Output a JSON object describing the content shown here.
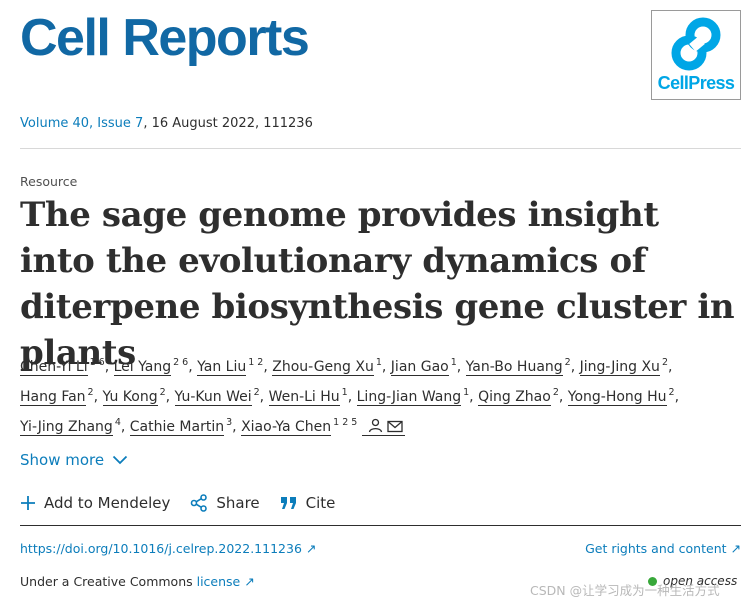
{
  "journal": {
    "title": "Cell Reports",
    "publisher_logo_text": "CellPress"
  },
  "citation": {
    "volume_issue": "Volume 40, Issue 7",
    "details": ", 16 August 2022, 111236"
  },
  "article": {
    "type": "Resource",
    "title": "The sage genome provides insight into the evolutionary dynamics of diterpene biosynthesis gene cluster in plants"
  },
  "authors": [
    {
      "name": "Chen-Yi Li",
      "aff": "1 6"
    },
    {
      "name": "Lei Yang",
      "aff": "2 6"
    },
    {
      "name": "Yan Liu",
      "aff": "1 2"
    },
    {
      "name": "Zhou-Geng Xu",
      "aff": "1"
    },
    {
      "name": "Jian Gao",
      "aff": "1"
    },
    {
      "name": "Yan-Bo Huang",
      "aff": "2"
    },
    {
      "name": "Jing-Jing Xu",
      "aff": "2"
    },
    {
      "name": "Hang Fan",
      "aff": "2"
    },
    {
      "name": "Yu Kong",
      "aff": "2"
    },
    {
      "name": "Yu-Kun Wei",
      "aff": "2"
    },
    {
      "name": "Wen-Li Hu",
      "aff": "1"
    },
    {
      "name": "Ling-Jian Wang",
      "aff": "1"
    },
    {
      "name": "Qing Zhao",
      "aff": "2"
    },
    {
      "name": "Yong-Hong Hu",
      "aff": "2"
    },
    {
      "name": "Yi-Jing Zhang",
      "aff": "4"
    },
    {
      "name": "Cathie Martin",
      "aff": "3"
    },
    {
      "name": "Xiao-Ya Chen",
      "aff": "1 2 5"
    }
  ],
  "actions": {
    "show_more": "Show more",
    "mendeley": "Add to Mendeley",
    "share": "Share",
    "cite": "Cite"
  },
  "links": {
    "doi": "https://doi.org/10.1016/j.celrep.2022.111236",
    "rights": "Get rights and content",
    "license_prefix": "Under a Creative Commons ",
    "license_link": "license",
    "open_access": "open access"
  },
  "watermark": "CSDN @让学习成为一种生活方式",
  "colors": {
    "brand": "#1168a4",
    "link": "#0c7dbb",
    "cellpress": "#00a6e6",
    "open_access_dot": "#38a83a"
  }
}
